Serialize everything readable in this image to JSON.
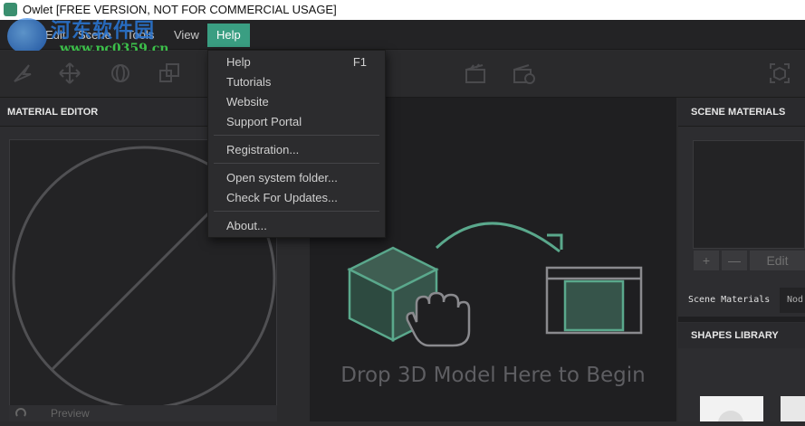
{
  "window": {
    "title": "Owlet [FREE VERSION, NOT FOR COMMERCIAL USAGE]"
  },
  "watermark": {
    "chinese": "河东软件园",
    "url": "www.pc0359.cn"
  },
  "menubar": {
    "items": [
      {
        "label": "Edit"
      },
      {
        "label": "Scene"
      },
      {
        "label": "Tools"
      },
      {
        "label": "View"
      },
      {
        "label": "Help"
      }
    ],
    "active": "Help"
  },
  "help_menu": {
    "items": [
      {
        "label": "Help",
        "shortcut": "F1"
      },
      {
        "label": "Tutorials"
      },
      {
        "label": "Website"
      },
      {
        "label": "Support Portal"
      },
      {
        "label": "Registration..."
      },
      {
        "label": "Open system folder..."
      },
      {
        "label": "Check For Updates..."
      },
      {
        "label": "About..."
      }
    ]
  },
  "panels": {
    "material_editor": {
      "title": "MATERIAL EDITOR",
      "bottom_label": "Preview"
    },
    "scene_materials": {
      "title": "SCENE MATERIALS",
      "add_label": "+",
      "remove_label": "—",
      "edit_label": "Edit",
      "tabs": [
        {
          "label": "Scene Materials"
        },
        {
          "label": "Nod"
        }
      ]
    },
    "shapes_library": {
      "title": "SHAPES LIBRARY"
    }
  },
  "viewport": {
    "drop_text": "Drop 3D Model Here to Begin"
  },
  "colors": {
    "accent": "#3a9e82",
    "background": "#2b2b2d",
    "viewport": "#1f1f21"
  }
}
